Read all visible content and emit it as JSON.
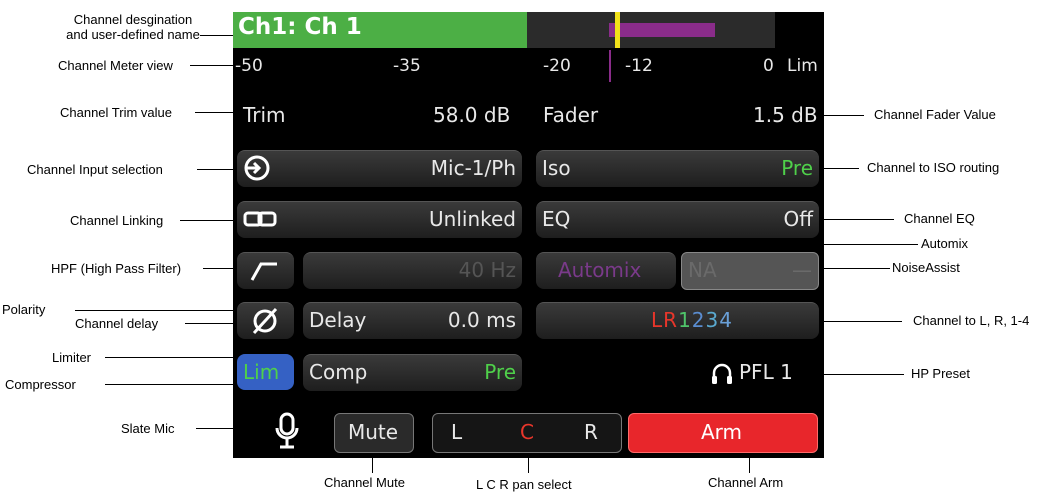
{
  "annotations": {
    "designation_line1": "Channel desgination",
    "designation_line2": "and user-defined name",
    "meter_view": "Channel Meter view",
    "trim_value": "Channel Trim value",
    "input_selection": "Channel Input selection",
    "linking": "Channel Linking",
    "hpf": "HPF (High Pass Filter)",
    "polarity": "Polarity",
    "delay": "Channel delay",
    "limiter": "Limiter",
    "compressor": "Compressor",
    "slate_mic": "Slate Mic",
    "fader_value": "Channel Fader Value",
    "iso_routing": "Channel to ISO routing",
    "eq": "Channel EQ",
    "automix": "Automix",
    "noiseassist": "NoiseAssist",
    "lr_routing": "Channel to L, R, 1-4",
    "hp_preset": "HP Preset",
    "mute": "Channel Mute",
    "pan_select": "L C R pan select",
    "arm": "Channel Arm"
  },
  "screen": {
    "channel_name": "Ch1: Ch 1",
    "meter_ticks": [
      "-50",
      "-35",
      "-20",
      "-12",
      "0",
      "Lim"
    ],
    "trim_label": "Trim",
    "trim_value": "58.0 dB",
    "fader_label": "Fader",
    "fader_value": "1.5 dB",
    "input_value": "Mic-1/Ph",
    "iso_label": "Iso",
    "iso_value": "Pre",
    "link_value": "Unlinked",
    "eq_label": "EQ",
    "eq_value": "Off",
    "hpf_value": "40 Hz",
    "automix_label": "Automix",
    "na_label": "NA",
    "na_dash": "—",
    "delay_label": "Delay",
    "delay_value": "0.0 ms",
    "routing": {
      "L": "L",
      "R": "R",
      "n1": "1",
      "n2": "2",
      "n3": "3",
      "n4": "4"
    },
    "lim_label": "Lim",
    "comp_label": "Comp",
    "comp_value": "Pre",
    "pfl_label": "PFL 1",
    "mute_label": "Mute",
    "pan": {
      "L": "L",
      "C": "C",
      "R": "R"
    },
    "arm_label": "Arm"
  },
  "colors": {
    "name_bar": "#4caf45",
    "meter_bar": "#8a2c8a",
    "peak_marker": "#f2e21a",
    "arm": "#e8262b",
    "lim_active": "#3561c4",
    "green_text": "#4fd04a"
  }
}
